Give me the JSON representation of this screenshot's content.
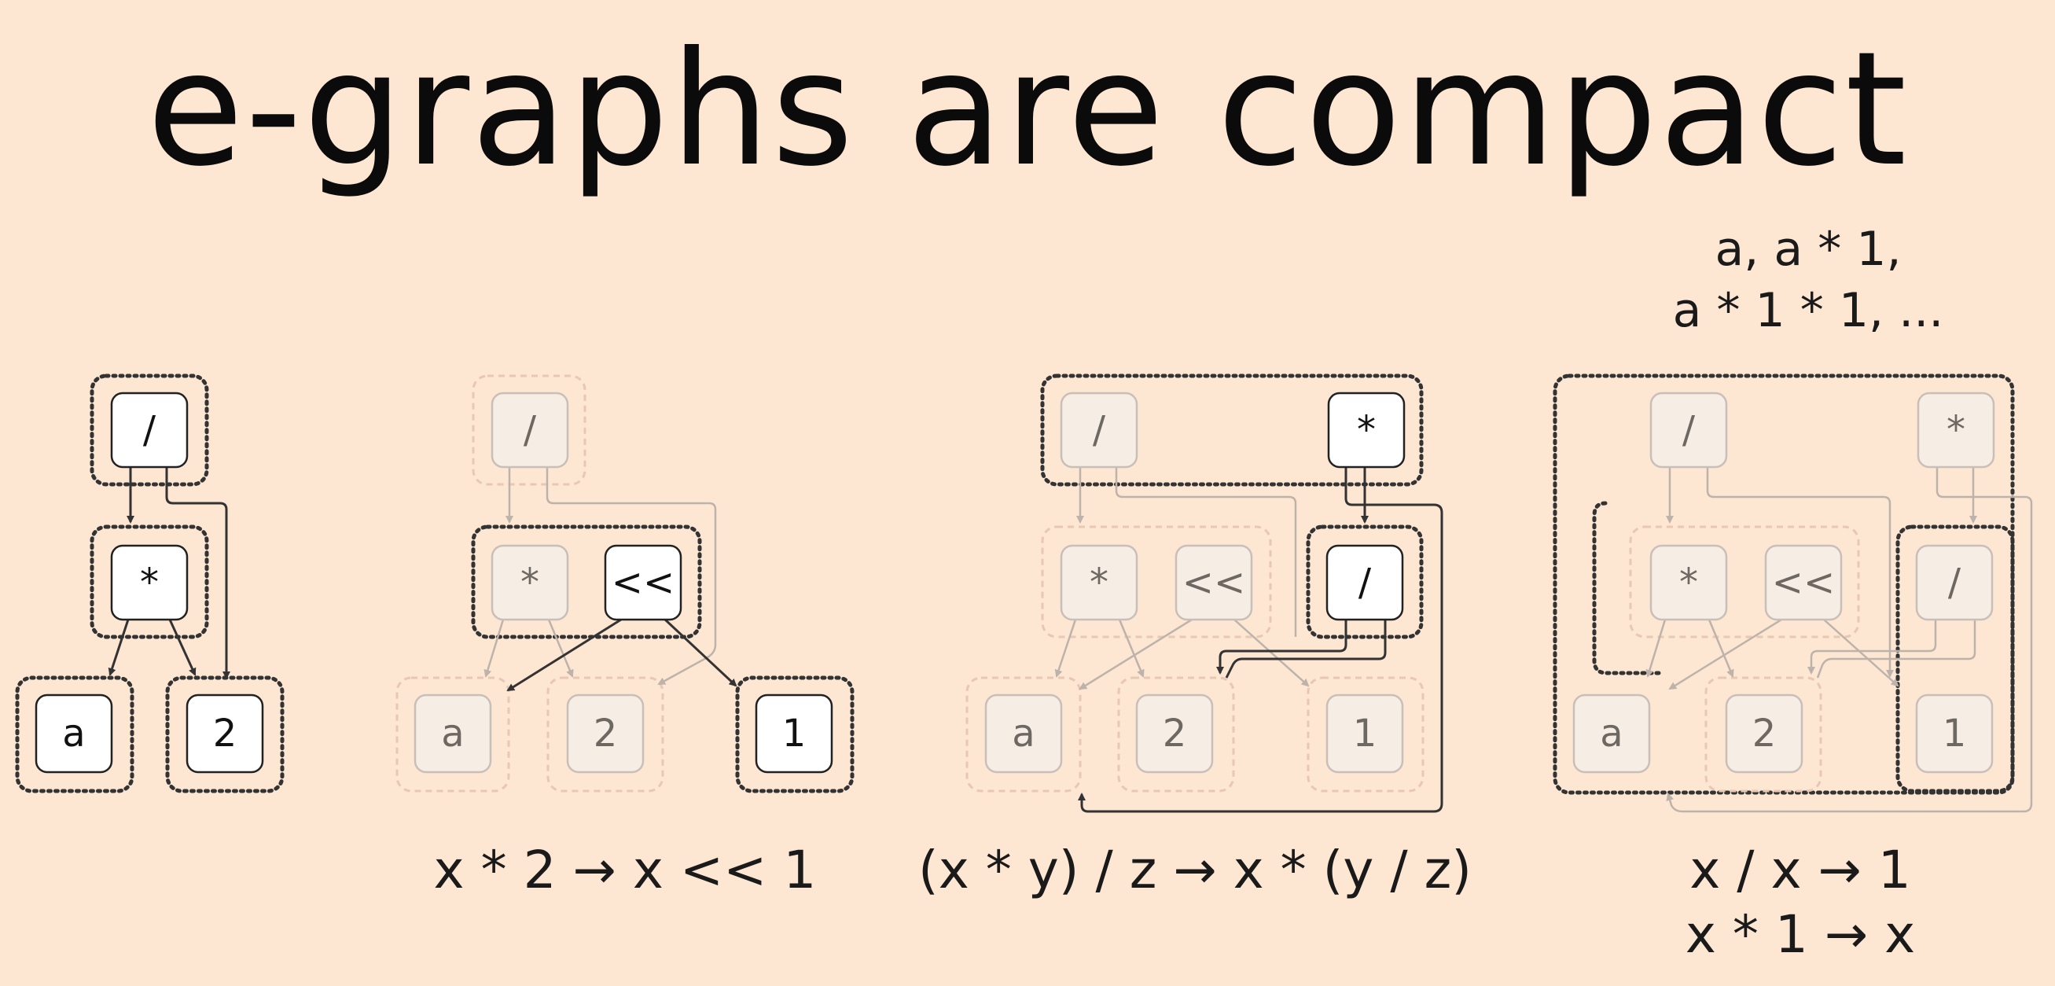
{
  "title": "e-graphs are compact",
  "panels": [
    {
      "nodes": [
        "/",
        "*",
        "a",
        "2"
      ],
      "caption": ""
    },
    {
      "nodes": [
        "/",
        "*",
        "<<",
        "a",
        "2",
        "1"
      ],
      "caption": "x * 2 → x << 1"
    },
    {
      "nodes": [
        "/",
        "*",
        "*",
        "<<",
        "/",
        "a",
        "2",
        "1"
      ],
      "caption": "(x * y) / z → x * (y / z)"
    },
    {
      "nodes": [
        "/",
        "*",
        "*",
        "<<",
        "/",
        "a",
        "2",
        "1"
      ],
      "caption_lines": [
        "x / x → 1",
        "x * 1 → x"
      ],
      "note_lines": [
        "a, a * 1,",
        "a * 1 * 1, ..."
      ]
    }
  ]
}
